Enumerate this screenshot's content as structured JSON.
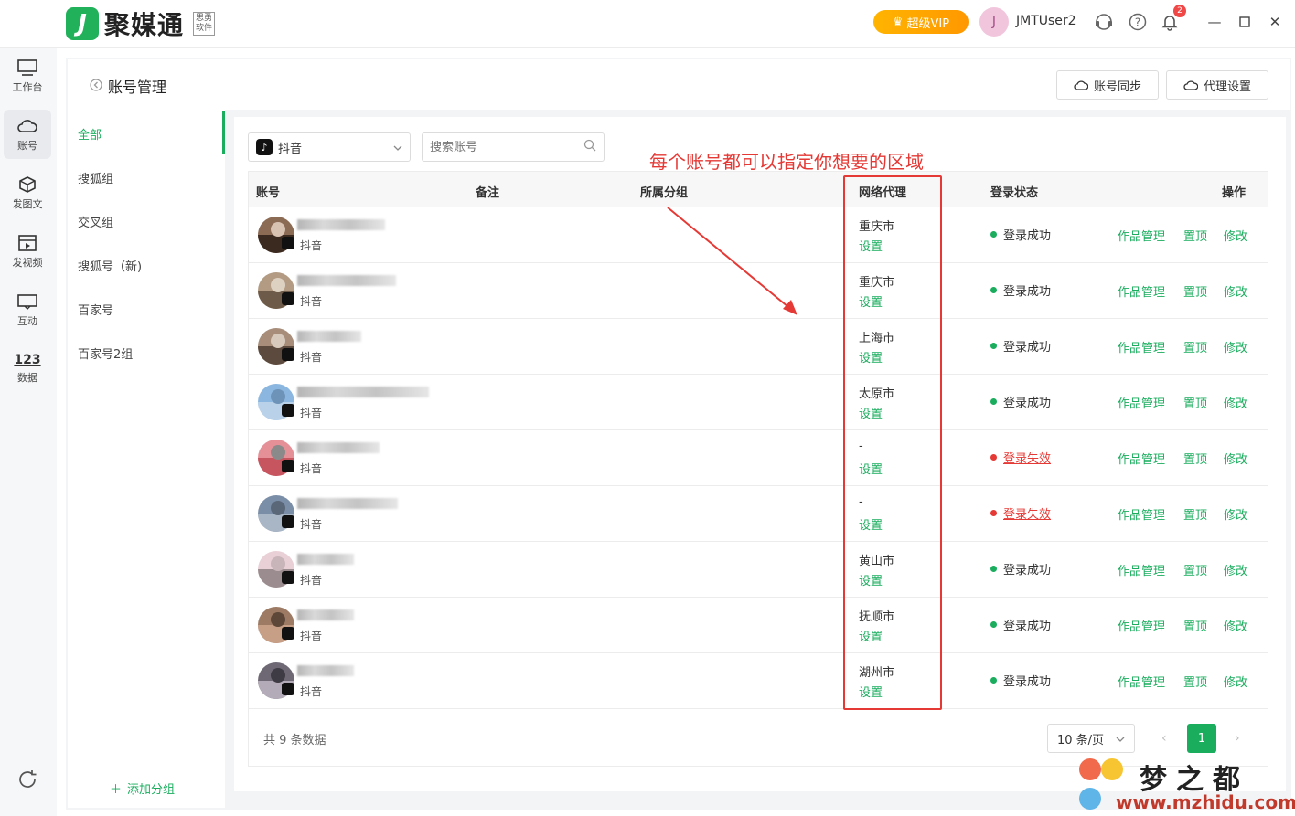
{
  "app": {
    "logo_char": "J",
    "name": "聚媒通",
    "sub_line1": "思勇",
    "sub_line2": "软件",
    "vip_label": "超级VIP",
    "user_initial": "J",
    "username": "JMTUser2",
    "notification_count": "2"
  },
  "nav": [
    {
      "label": "工作台",
      "icon": "monitor-icon"
    },
    {
      "label": "账号",
      "icon": "cloud-icon"
    },
    {
      "label": "发图文",
      "icon": "cube-icon"
    },
    {
      "label": "发视频",
      "icon": "video-board-icon"
    },
    {
      "label": "互动",
      "icon": "screen-icon"
    },
    {
      "label": "数据",
      "icon": "numbers-icon"
    }
  ],
  "nav_numbers_glyph": "123",
  "page": {
    "title": "账号管理",
    "sync_button": "账号同步",
    "proxy_button": "代理设置"
  },
  "groups": [
    "全部",
    "搜狐组",
    "交叉组",
    "搜狐号（新)",
    "百家号",
    "百家号2组"
  ],
  "add_group_label": "添加分组",
  "filter": {
    "platform": "抖音",
    "search_placeholder": "搜索账号"
  },
  "annotation": "每个账号都可以指定你想要的区域",
  "table": {
    "headers": {
      "account": "账号",
      "note": "备注",
      "group": "所属分组",
      "proxy": "网络代理",
      "status": "登录状态",
      "ops": "操作"
    },
    "rows": [
      {
        "platform": "抖音",
        "proxy": "重庆市",
        "set": "设置",
        "status": "登录成功",
        "ok": true
      },
      {
        "platform": "抖音",
        "proxy": "重庆市",
        "set": "设置",
        "status": "登录成功",
        "ok": true
      },
      {
        "platform": "抖音",
        "proxy": "上海市",
        "set": "设置",
        "status": "登录成功",
        "ok": true
      },
      {
        "platform": "抖音",
        "proxy": "太原市",
        "set": "设置",
        "status": "登录成功",
        "ok": true
      },
      {
        "platform": "抖音",
        "proxy": "-",
        "set": "设置",
        "status": "登录失效",
        "ok": false
      },
      {
        "platform": "抖音",
        "proxy": "-",
        "set": "设置",
        "status": "登录失效",
        "ok": false
      },
      {
        "platform": "抖音",
        "proxy": "黄山市",
        "set": "设置",
        "status": "登录成功",
        "ok": true
      },
      {
        "platform": "抖音",
        "proxy": "抚顺市",
        "set": "设置",
        "status": "登录成功",
        "ok": true
      },
      {
        "platform": "抖音",
        "proxy": "湖州市",
        "set": "设置",
        "status": "登录成功",
        "ok": true
      }
    ],
    "ops": [
      "作品管理",
      "置顶",
      "修改"
    ]
  },
  "pagination": {
    "total": "共 9 条数据",
    "page_size": "10 条/页",
    "current": "1"
  },
  "watermark": {
    "title": "梦之都",
    "url": "www.mzhidu.com"
  },
  "colors": {
    "accent": "#1aad5e",
    "danger": "#e53935",
    "vip": "#ffa000"
  }
}
